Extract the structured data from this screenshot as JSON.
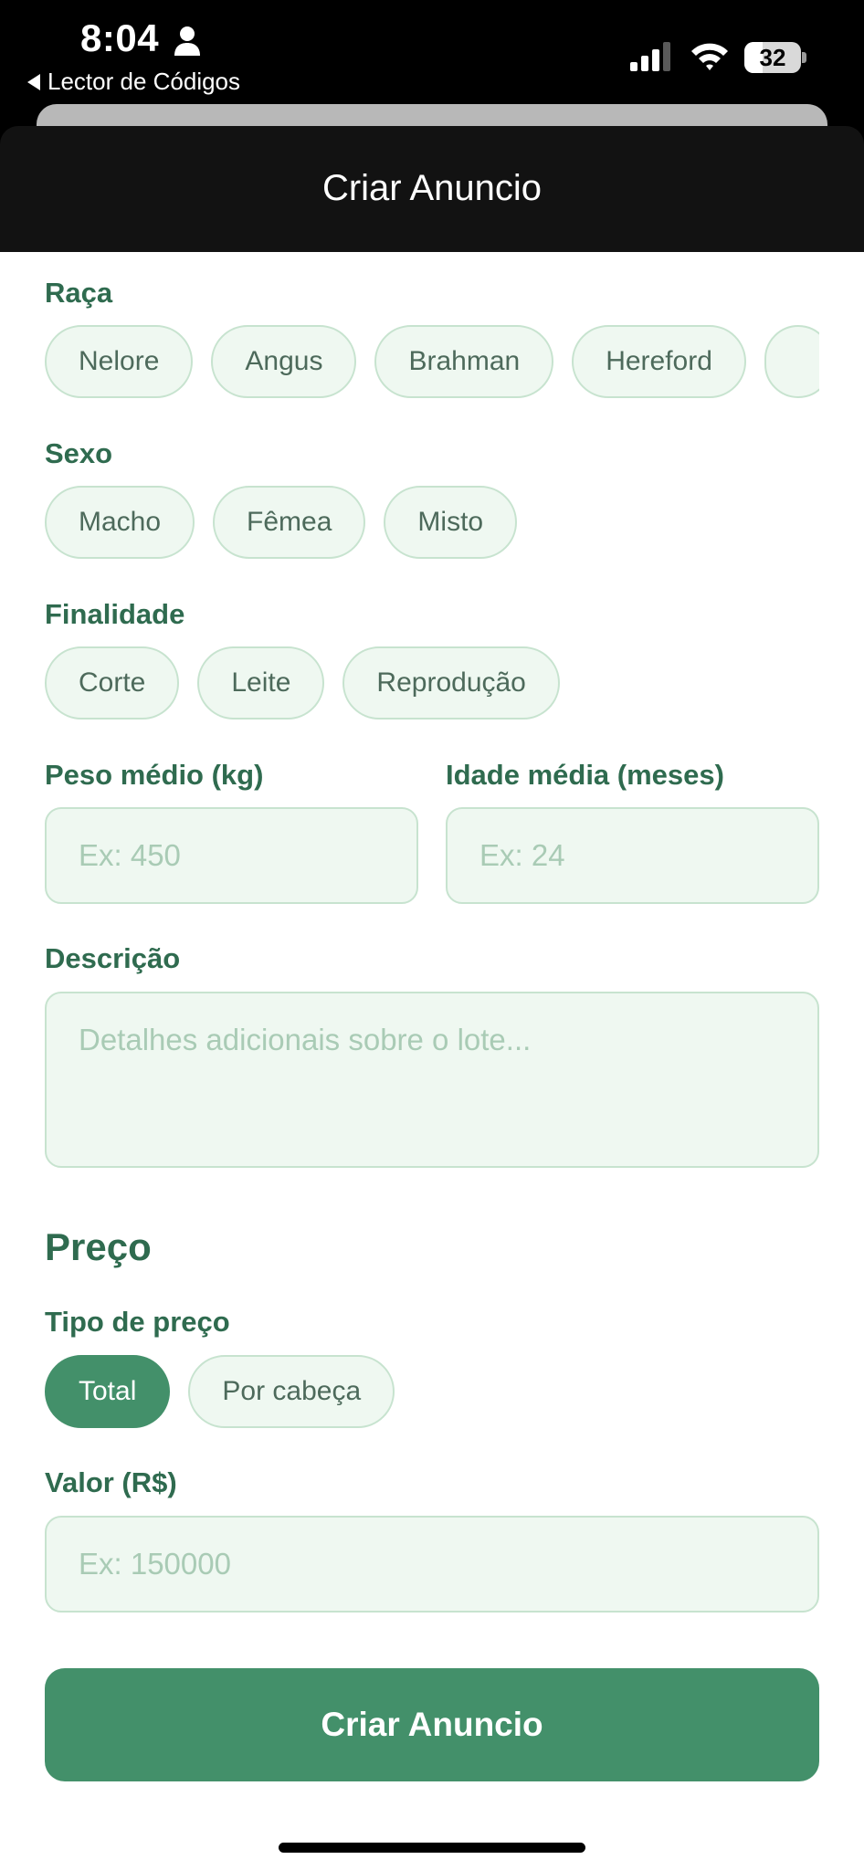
{
  "status_bar": {
    "time": "8:04",
    "back_app": "Lector de Códigos",
    "battery": "32",
    "battery_level": 0.32
  },
  "header": {
    "title": "Criar Anuncio"
  },
  "form": {
    "raca": {
      "label": "Raça",
      "options": [
        "Nelore",
        "Angus",
        "Brahman",
        "Hereford",
        ""
      ]
    },
    "sexo": {
      "label": "Sexo",
      "options": [
        "Macho",
        "Fêmea",
        "Misto"
      ]
    },
    "finalidade": {
      "label": "Finalidade",
      "options": [
        "Corte",
        "Leite",
        "Reprodução"
      ]
    },
    "peso": {
      "label": "Peso médio (kg)",
      "placeholder": "Ex: 450"
    },
    "idade": {
      "label": "Idade média (meses)",
      "placeholder": "Ex: 24"
    },
    "descricao": {
      "label": "Descrição",
      "placeholder": "Detalhes adicionais sobre o lote..."
    }
  },
  "preco": {
    "title": "Preço",
    "tipo": {
      "label": "Tipo de preço",
      "options": [
        "Total",
        "Por cabeça"
      ],
      "selected": "Total"
    },
    "valor": {
      "label": "Valor (R$)",
      "placeholder": "Ex: 150000"
    }
  },
  "submit_label": "Criar Anuncio",
  "colors": {
    "accent": "#43906a",
    "label": "#2f6b4f",
    "chip_bg": "#eff8f1",
    "chip_border": "#c7e3cf",
    "header_bg": "#121212"
  },
  "icons": [
    "person-icon",
    "back-arrow-icon",
    "signal-icon",
    "wifi-icon",
    "battery-icon"
  ]
}
